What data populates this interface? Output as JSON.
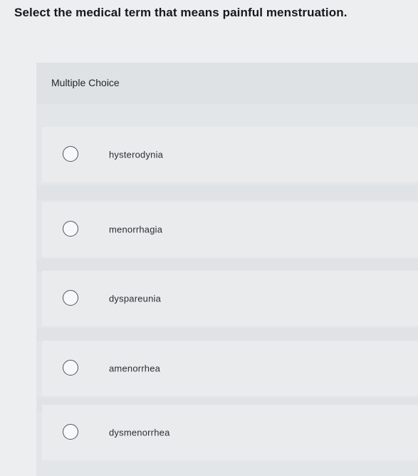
{
  "question": "Select the medical term that means painful menstruation.",
  "section_title": "Multiple Choice",
  "options": [
    {
      "label": "hysterodynia",
      "selected": false
    },
    {
      "label": "menorrhagia",
      "selected": false
    },
    {
      "label": "dyspareunia",
      "selected": false
    },
    {
      "label": "amenorrhea",
      "selected": false
    },
    {
      "label": "dysmenorrhea",
      "selected": false
    }
  ]
}
